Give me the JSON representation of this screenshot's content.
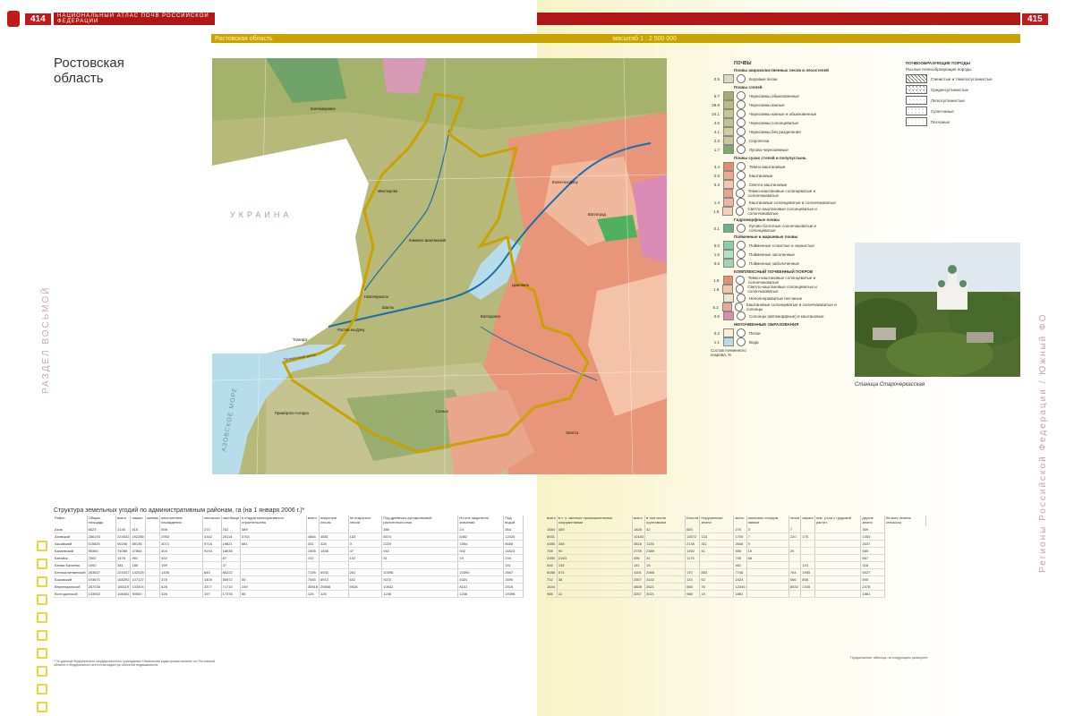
{
  "header": {
    "left_page": "414",
    "right_page": "415",
    "left_running_title": "НАЦИОНАЛЬНЫЙ АТЛАС ПОЧВ РОССИЙСКОЙ ФЕДЕРАЦИИ",
    "map_region_label": "Ростовская область",
    "scale_label": "масштаб 1 : 2 500 000"
  },
  "page_title": "Ростовская область",
  "side_left": "РАЗДЕЛ ВОСЬМОЙ",
  "side_right": "Регионы Российской Федерации / Южный ФО",
  "map": {
    "labels": {
      "country": "УКРАИНА",
      "sea": "АЗОВСКОЕ МОРЕ",
      "cities": [
        "Ростов-на-Дону",
        "Таганрог",
        "Новочеркасск",
        "Шахты",
        "Волгодонск",
        "Цимлянск",
        "Сальск",
        "Элиста",
        "Примо́рско-Ахтарск",
        "Миллерово",
        "Каменск-Шахтинский",
        "Волгоград",
        "Калач-на-Дону",
        "Кантемировка"
      ],
      "gulf": "Таганрогский залив"
    },
    "colors": {
      "chernozem": "#b4b978",
      "chernozem_dark": "#8a9a55",
      "chestnut": "#e8957a",
      "chestnut_light": "#f3b99c",
      "meadow": "#7fc69a",
      "water": "#b8dcea",
      "boundary": "#c8a200",
      "river": "#1a6ea8",
      "solonetz": "#d98ab5"
    }
  },
  "legend": {
    "title": "ПОЧВЫ",
    "groups": [
      {
        "head": "Почвы широколиственных лесов и лесостепей",
        "items": [
          {
            "pct": "0.5",
            "code": "Б1",
            "label": "Боровые пески",
            "color": "#d9dcc4"
          }
        ]
      },
      {
        "head": "Почвы степей",
        "items": [
          {
            "pct": "5.7",
            "code": "Ч",
            "label": "Черноземы обыкновенные",
            "color": "#a9ad6c"
          },
          {
            "pct": "28.8",
            "code": "Ч",
            "label": "Черноземы южные",
            "color": "#b9bb80"
          },
          {
            "pct": "24.1",
            "code": "Ч",
            "label": "Черноземы южные и обыкновенные",
            "color": "#c6c68c"
          },
          {
            "pct": "4.6",
            "code": "Ч",
            "label": "Черноземы солонцеватые",
            "color": "#bfc28a"
          },
          {
            "pct": "4.1",
            "code": "Ч",
            "label": "Черноземы без разделения",
            "color": "#cfcf9a"
          },
          {
            "pct": "2.2",
            "code": "",
            "label": "Серопески",
            "color": "#cfc59a"
          },
          {
            "pct": "1.7",
            "code": "Ч",
            "label": "Лугово-черноземные",
            "color": "#7fa86a"
          }
        ]
      },
      {
        "head": "Почвы сухих степей и полупустынь",
        "items": [
          {
            "pct": "3.4",
            "code": "К",
            "label": "Темно-каштановые",
            "color": "#e88b6c"
          },
          {
            "pct": "2.0",
            "code": "К",
            "label": "Каштановые",
            "color": "#f0a98c"
          },
          {
            "pct": "0.3",
            "code": "К",
            "label": "Светло-каштановые",
            "color": "#f6c8b0"
          },
          {
            "pct": "",
            "code": "",
            "label": "Темно-каштановые солонцеватые и солончаковатые",
            "color": "#eaa28a"
          },
          {
            "pct": "1.4",
            "code": "",
            "label": "Каштановые солонцеватые и солончаковатые",
            "color": "#efb59c"
          },
          {
            "pct": "1.8",
            "code": "",
            "label": "Светло-каштановые солонцеватые и солончаковатые",
            "color": "#f6d0bc"
          }
        ]
      },
      {
        "head": "Гидроморфные почвы",
        "items": [
          {
            "pct": "0.1",
            "code": "",
            "label": "Лугово-болотные солончаковатые и солонцеватые",
            "color": "#6bb08a"
          }
        ]
      },
      {
        "head": "Пойменные и маршевые почвы",
        "items": [
          {
            "pct": "5.0",
            "code": "",
            "label": "Пойменные слоистые и зернистые",
            "color": "#8ad0a0"
          },
          {
            "pct": "1.5",
            "code": "",
            "label": "Пойменные засоленные",
            "color": "#b4e0c0"
          },
          {
            "pct": "0.5",
            "code": "",
            "label": "Пойменные заболоченные",
            "color": "#9fd8b0"
          }
        ]
      },
      {
        "head": "КОМПЛЕКСНЫЙ ПОЧВЕННЫЙ ПОКРОВ",
        "items": [
          {
            "pct": "1.9",
            "code": "",
            "label": "Темно-каштановые солонцеватые и солончаковатые",
            "color": "#e48f70"
          },
          {
            "pct": "1.8",
            "code": "",
            "label": "Светло-каштановые солонцеватые и солончаковатые",
            "color": "#f4c4a8"
          },
          {
            "pct": "",
            "code": "",
            "label": "Неполноразвитые песчаные",
            "color": "#f1e4d0"
          },
          {
            "pct": "5.2",
            "code": "",
            "label": "Каштановые солонцеватые и солончаковатые и солонцы",
            "color": "#e9aa90"
          },
          {
            "pct": "0.6",
            "code": "",
            "label": "Солонцы (автоморфные) и каштановые",
            "color": "#d98ab5"
          }
        ]
      },
      {
        "head": "НЕПОЧВЕННЫЕ ОБРАЗОВАНИЯ",
        "items": [
          {
            "pct": "0.2",
            "code": "П",
            "label": "Пески",
            "color": "#f5efd8"
          },
          {
            "pct": "1.1",
            "code": "",
            "label": "Вода",
            "color": "#b8dcea"
          }
        ]
      }
    ],
    "note": "Состав почвенного покрова, %"
  },
  "parent_rock": {
    "head1": "ПОЧВООБРАЗУЮЩИЕ ПОРОДЫ",
    "head2": "Рыхлые почвообразующие породы",
    "items": [
      "Глинистые и тяжелосуглинистые",
      "Среднесуглинистые",
      "Легкосуглинистые",
      "Супесчаные",
      "Песчаные"
    ]
  },
  "photo_caption": "Станица Старочеркасская",
  "table": {
    "title": "Структура земельных угодий по административным районам, га (на 1 января 2006 г.)*",
    "left_headers": [
      "Район",
      "Общая площадь",
      "всего",
      "пашня",
      "залежь",
      "многолетние насаждения",
      "сенокосы",
      "пастбища",
      "в стадии мелиоративного строительства",
      "всего",
      "покрытые лесом",
      "не покрытые лесом",
      "Под древесно-кустарниковой растительностью",
      "Из них защитного значения",
      "Под водой"
    ],
    "right_headers": [
      "всего",
      "в т. ч. занятые промышленными сооружениями",
      "всего",
      "в том числе грунтовыми",
      "Болота",
      "Нарушенные земли",
      "всего",
      "полигоны отходов, свалки",
      "пески",
      "овраги",
      "зем. уч-ки с грудовой растит.",
      "другие земли",
      "Из всех земель сенокосы"
    ],
    "left_rows": [
      [
        "Азов",
        "6623",
        "2145",
        "515",
        "",
        "598",
        "270",
        "762",
        "389",
        "",
        "",
        "",
        "380",
        "24",
        "364"
      ],
      [
        "Азовский",
        "286193",
        "224532",
        "192285",
        "",
        "2953",
        "4162",
        "25114",
        "3763",
        "4864",
        "4681",
        "183",
        "6574",
        "6452",
        "12025"
      ],
      [
        "Аксайский",
        "115625",
        "90246",
        "58136",
        "",
        "3071",
        "9716",
        "19821",
        "681",
        "331",
        "328",
        "3",
        "2220",
        "1504",
        "8655"
      ],
      [
        "Багаевский",
        "95360",
        "74085",
        "47564",
        "",
        "303",
        "9193",
        "18035",
        "",
        "1505",
        "1458",
        "47",
        "942",
        "942",
        "11823"
      ],
      [
        "Батайск",
        "7502",
        "1478",
        "951",
        "",
        "432",
        "",
        "87",
        "",
        "102",
        "",
        "102",
        "31",
        "19",
        "234"
      ],
      [
        "Белая Калитва",
        "1690",
        "381",
        "185",
        "",
        "159",
        "",
        "37",
        "",
        "",
        "",
        "",
        "",
        "",
        "151"
      ],
      [
        "Белокалитвинский",
        "263637",
        "224347",
        "142025",
        "",
        "1455",
        "645",
        "80222",
        "",
        "7195",
        "6934",
        "261",
        "10398",
        "10390",
        "2667"
      ],
      [
        "Боковский",
        "193671",
        "168292",
        "107127",
        "",
        "378",
        "1405",
        "55972",
        "35",
        "7545",
        "6913",
        "632",
        "9270",
        "6324",
        "1690"
      ],
      [
        "Верхнедонской",
        "267036",
        "185119",
        "133404",
        "",
        "628",
        "3377",
        "71710",
        "249",
        "35818",
        "29858",
        "5928",
        "10542",
        "8141",
        "2516"
      ],
      [
        "Волгодонской",
        "133552",
        "108481",
        "90550",
        "",
        "326",
        "197",
        "17376",
        "55",
        "126",
        "126",
        "",
        "1246",
        "1246",
        "19398"
      ]
    ],
    "right_rows": [
      [
        "1584",
        "469",
        "1828",
        "42",
        "683",
        "",
        "270",
        "3",
        "7",
        "",
        "",
        "369"
      ],
      [
        "8931",
        "",
        "10183",
        "",
        "13572",
        "134",
        "1705",
        "7",
        "220",
        "175",
        "",
        "1303"
      ],
      [
        "4385",
        "348",
        "3818",
        "1135",
        "2146",
        "311",
        "2646",
        "9",
        "",
        "",
        "",
        "2637"
      ],
      [
        "708",
        "90",
        "2739",
        "2389",
        "1392",
        "41",
        "555",
        "15",
        "20",
        "",
        "",
        "580"
      ],
      [
        "3350",
        "2163",
        "495",
        "31",
        "1175",
        "",
        "735",
        "68",
        "",
        "",
        "",
        "667"
      ],
      [
        "546",
        "134",
        "141",
        "15",
        "",
        "",
        "461",
        "",
        "",
        "143",
        "",
        "318"
      ],
      [
        "6088",
        "574",
        "4151",
        "2066",
        "170",
        "883",
        "7746",
        "",
        "764",
        "1955",
        "",
        "5027"
      ],
      [
        "732",
        "38",
        "2507",
        "3142",
        "134",
        "52",
        "2424",
        "",
        "566",
        "858",
        "",
        "590"
      ],
      [
        "1644",
        "",
        "4808",
        "2621",
        "558",
        "76",
        "12345",
        "",
        "8532",
        "1345",
        "",
        "2478"
      ],
      [
        "985",
        "11",
        "3257",
        "3021",
        "988",
        "15",
        "1881",
        "",
        "",
        "",
        "",
        "1881"
      ]
    ],
    "footnote": "* По данным Федерального государственного учреждения «Земельная кадастровая палата» по Ростовской области и Федерального агентства кадастра объектов недвижимости.",
    "continue_note": "Продолжение таблицы на следующем развороте"
  }
}
